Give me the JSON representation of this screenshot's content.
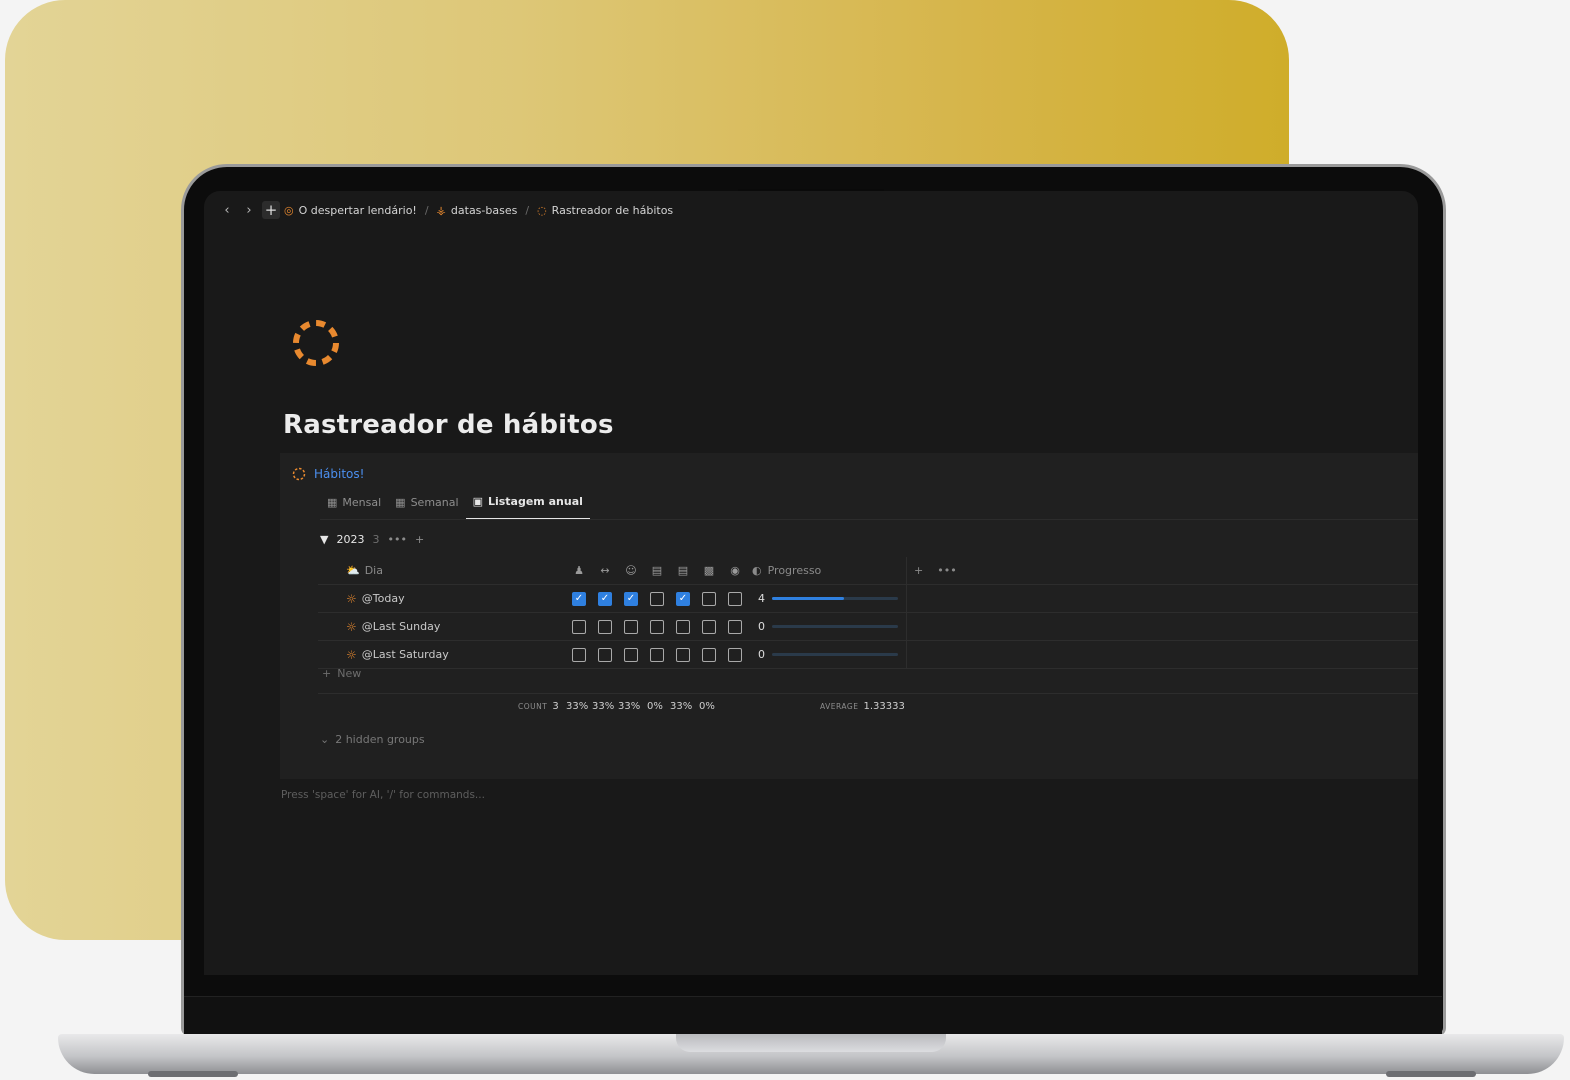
{
  "colors": {
    "accent_blue": "#2f80e0",
    "orange": "#e8892f",
    "gold": "#d6b54a"
  },
  "topbar": {
    "back_icon": "chevron-left-icon",
    "forward_icon": "chevron-right-icon",
    "new_icon": "plus-icon",
    "breadcrumbs": [
      {
        "label": "O despertar lendário!",
        "icon": "target-icon"
      },
      {
        "label": "datas-bases",
        "icon": "database-icon"
      },
      {
        "label": "Rastreador de hábitos",
        "icon": "dashed-circle-icon"
      }
    ],
    "separator": "/"
  },
  "page": {
    "title": "Rastreador de hábitos",
    "icon": "dashed-circle-icon"
  },
  "database": {
    "title": "Hábitos!",
    "tabs": [
      {
        "label": "Mensal",
        "icon": "calendar-grid-icon",
        "active": false
      },
      {
        "label": "Semanal",
        "icon": "calendar-grid-icon",
        "active": false
      },
      {
        "label": "Listagem anual",
        "icon": "calendar-icon",
        "active": true
      }
    ],
    "group": {
      "label": "2023",
      "count": "3",
      "more": "•••",
      "add": "+"
    },
    "columns": {
      "name": "Dia",
      "habit_icons": [
        "person-icon",
        "dumbbell-icon",
        "meditation-icon",
        "book-icon",
        "notebook-icon",
        "pages-icon",
        "fire-icon"
      ],
      "progress": "Progresso",
      "add": "+",
      "more": "•••"
    },
    "rows": [
      {
        "name": "@Today",
        "checks": [
          true,
          true,
          true,
          false,
          true,
          false,
          false
        ],
        "progress_value": "4",
        "progress_fraction": 0.57
      },
      {
        "name": "@Last Sunday",
        "checks": [
          false,
          false,
          false,
          false,
          false,
          false,
          false
        ],
        "progress_value": "0",
        "progress_fraction": 0
      },
      {
        "name": "@Last Saturday",
        "checks": [
          false,
          false,
          false,
          false,
          false,
          false,
          false
        ],
        "progress_value": "0",
        "progress_fraction": 0
      }
    ],
    "new_label": "New",
    "calculations": {
      "count_label": "COUNT",
      "count_value": "3",
      "percents": [
        "33%",
        "33%",
        "33%",
        "0%",
        "33%",
        "0%"
      ],
      "average_label": "AVERAGE",
      "average_value": "1.33333"
    },
    "hidden_groups": "2 hidden groups"
  },
  "hint": "Press 'space' for AI, '/' for commands..."
}
